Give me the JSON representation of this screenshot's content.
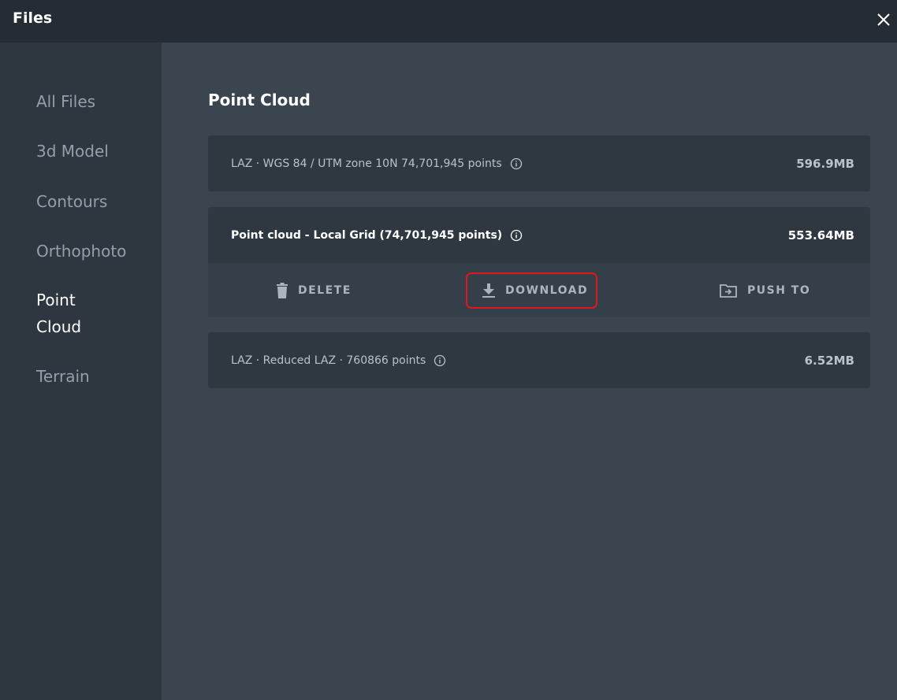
{
  "header": {
    "title": "Files",
    "close_icon": "close-icon"
  },
  "sidebar": {
    "items": [
      {
        "label": "All Files",
        "active": false
      },
      {
        "label": "3d Model",
        "active": false
      },
      {
        "label": "Contours",
        "active": false
      },
      {
        "label": "Orthophoto",
        "active": false
      },
      {
        "label": "Point Cloud",
        "active": true
      },
      {
        "label": "Terrain",
        "active": false
      }
    ]
  },
  "main": {
    "section_title": "Point Cloud",
    "files": [
      {
        "name": "LAZ · WGS 84 / UTM zone 10N 74,701,945 points",
        "size": "596.9MB"
      },
      {
        "name": "Point cloud - Local Grid (74,701,945 points)",
        "size": "553.64MB",
        "selected": true
      },
      {
        "name": "LAZ · Reduced LAZ · 760866 points",
        "size": "6.52MB"
      }
    ],
    "actions": {
      "delete_label": "DELETE",
      "download_label": "DOWNLOAD",
      "push_label": "PUSH TO"
    }
  },
  "colors": {
    "highlight": "#e0171a",
    "background": "#3a4550",
    "sidebar": "#2e363f"
  }
}
